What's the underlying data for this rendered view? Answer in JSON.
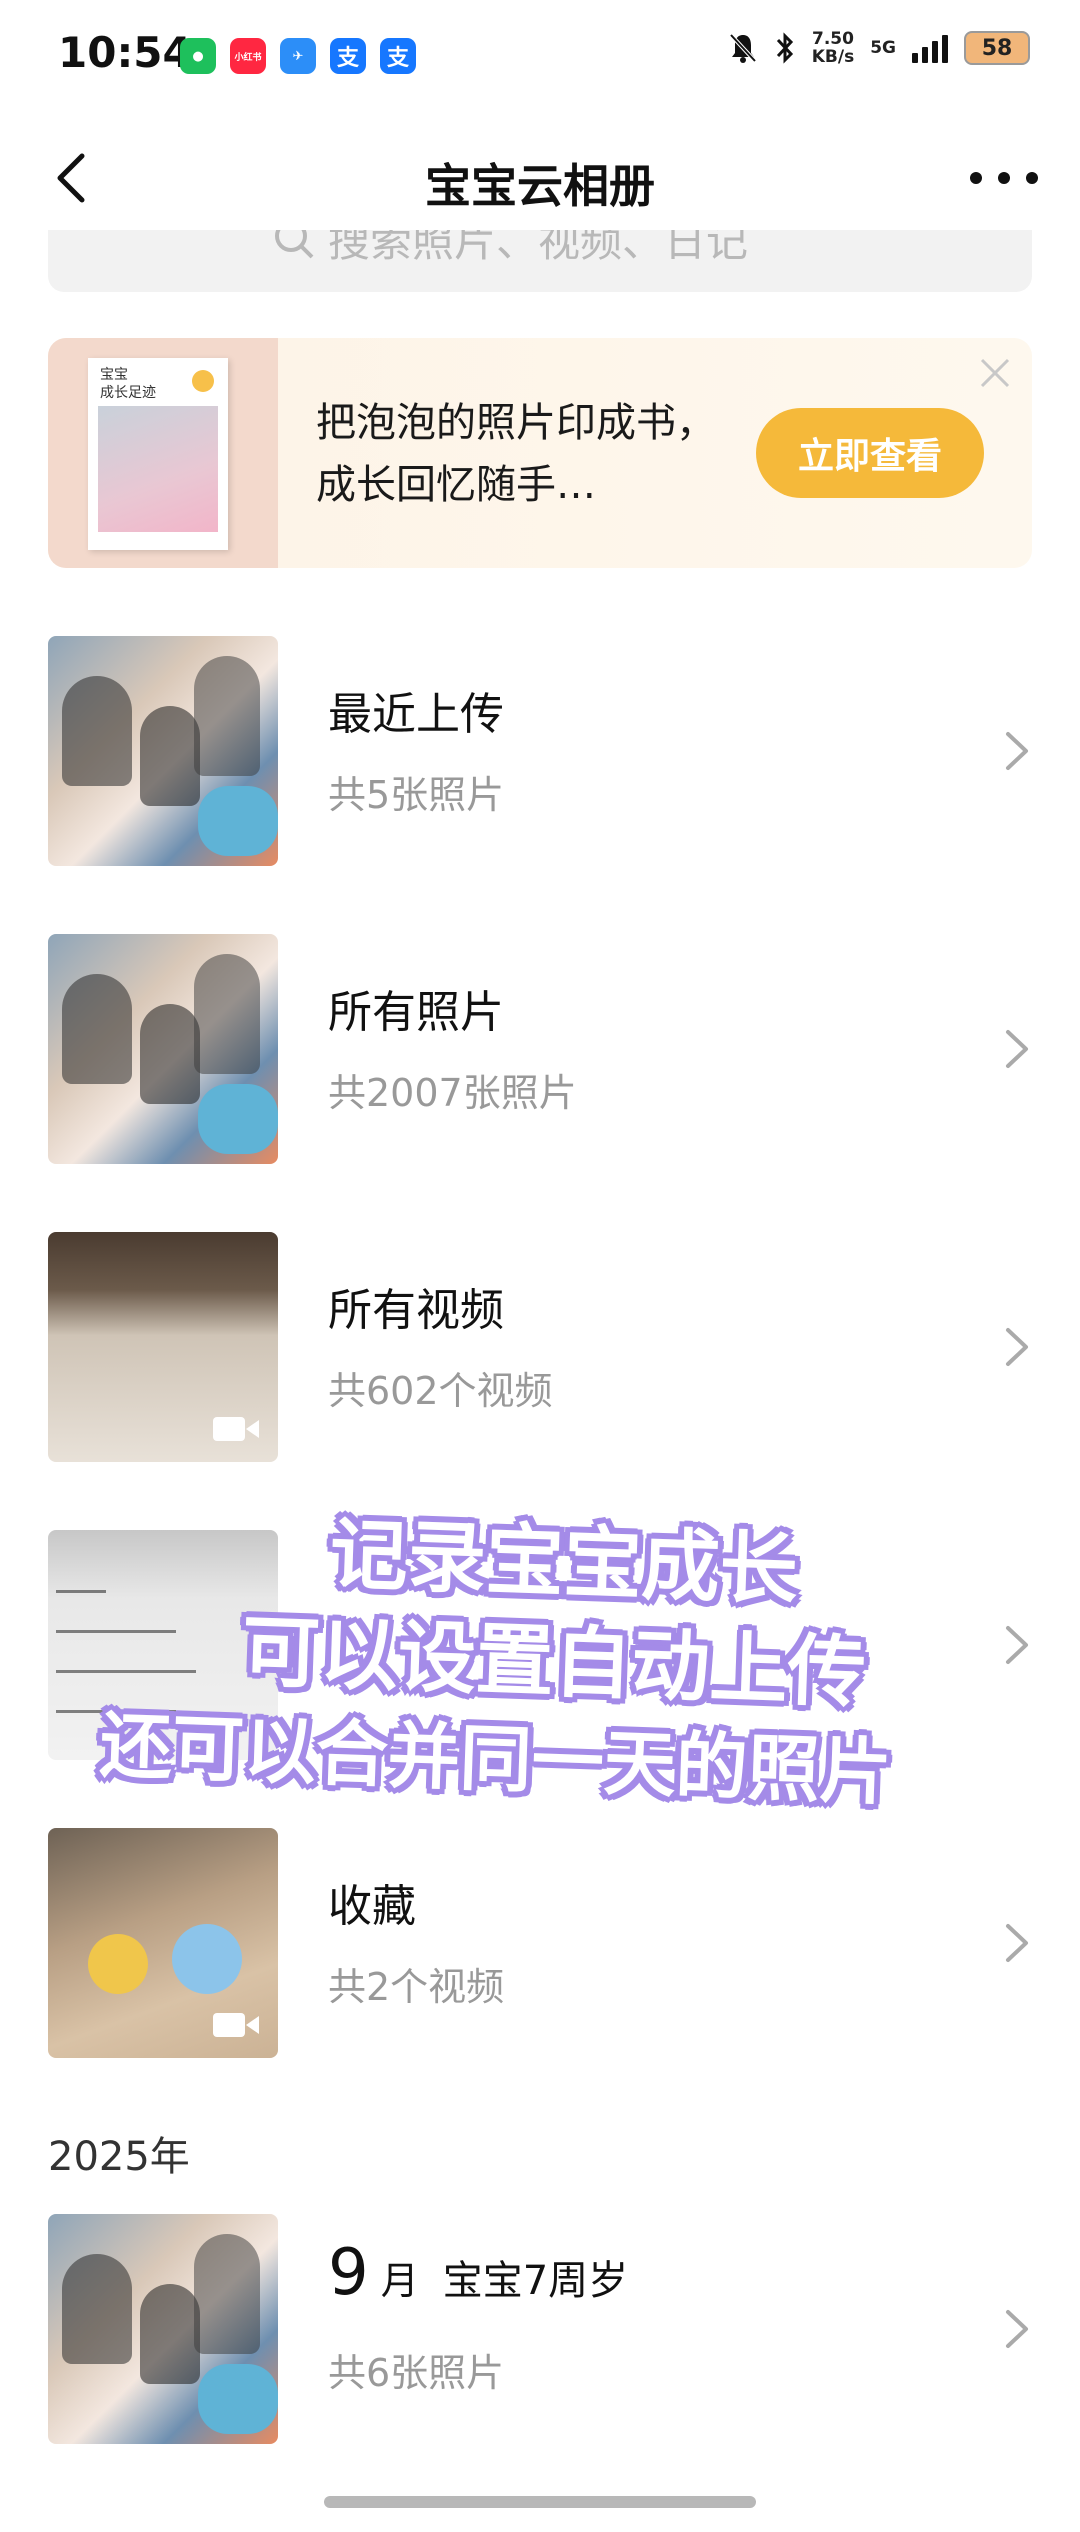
{
  "status_bar": {
    "time": "10:54",
    "apps": [
      {
        "name": "wechat-icon",
        "color": "#1ec05c",
        "glyph": "●"
      },
      {
        "name": "xiaohongshu-icon",
        "color": "#ff2741",
        "glyph": "小红书"
      },
      {
        "name": "app-icon",
        "color": "#2c8ef8",
        "glyph": "✈"
      },
      {
        "name": "alipay-icon",
        "color": "#1677ff",
        "glyph": "支"
      },
      {
        "name": "alipay-icon-2",
        "color": "#1677ff",
        "glyph": "支"
      }
    ],
    "speed_value": "7.50",
    "speed_unit": "KB/s",
    "network": "5G",
    "battery": "58"
  },
  "nav": {
    "title": "宝宝云相册"
  },
  "search": {
    "placeholder": "搜索照片、视频、日记"
  },
  "banner": {
    "book_title": "宝宝\n成长足迹",
    "text": "把泡泡的照片印成书，成长回忆随手…",
    "button": "立即查看"
  },
  "albums": [
    {
      "title": "最近上传",
      "subtitle": "共5张照片"
    },
    {
      "title": "所有照片",
      "subtitle": "共2007张照片"
    },
    {
      "title": "所有视频",
      "subtitle": "共602个视频"
    },
    {
      "title": "",
      "subtitle": ""
    },
    {
      "title": "收藏",
      "subtitle": "共2个视频"
    }
  ],
  "section": {
    "year": "2025年",
    "month_num": "9",
    "month_unit": "月",
    "month_note": "宝宝7周岁",
    "month_count": "共6张照片"
  },
  "overlay": {
    "line1": "记录宝宝成长",
    "line2": "可以设置自动上传",
    "line3": "还可以合并同一天的照片"
  },
  "colors": {
    "accent": "#f5b93a",
    "overlay_stroke": "#a48be8"
  }
}
